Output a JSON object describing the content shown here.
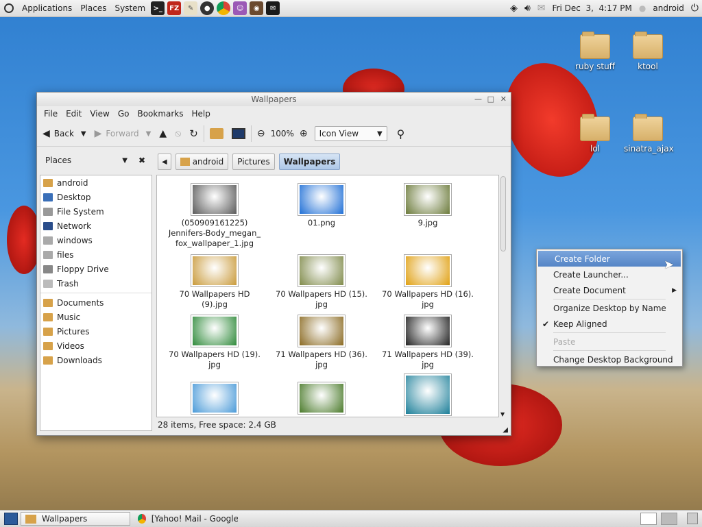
{
  "top_panel": {
    "menus": [
      "Applications",
      "Places",
      "System"
    ],
    "launchers": [
      "terminal-icon",
      "filezilla-icon",
      "text-editor-icon",
      "media-player-icon",
      "chrome-icon",
      "chat-icon",
      "camera-icon",
      "xchat-icon"
    ],
    "clock": "Fri Dec  3,  4:17 PM",
    "user": "android"
  },
  "desktop_icons": [
    "ruby stuff",
    "ktool",
    "lol",
    "sinatra_ajax"
  ],
  "window": {
    "title": "Wallpapers",
    "menu": [
      "File",
      "Edit",
      "View",
      "Go",
      "Bookmarks",
      "Help"
    ],
    "toolbar": {
      "back": "Back",
      "forward": "Forward",
      "zoom": "100%",
      "view_mode": "Icon View"
    },
    "sidebar": {
      "header": "Places",
      "items": [
        "android",
        "Desktop",
        "File System",
        "Network",
        "windows",
        "files",
        "Floppy Drive",
        "Trash"
      ],
      "bookmarks": [
        "Documents",
        "Music",
        "Pictures",
        "Videos",
        "Downloads"
      ]
    },
    "breadcrumbs": [
      "android",
      "Pictures",
      "Wallpapers"
    ],
    "files": [
      {
        "name": "(050909161225) Jennifers-Body_megan_ fox_wallpaper_1.jpg",
        "color": "#5a5a5a"
      },
      {
        "name": "01.png",
        "color": "#1f6fd6"
      },
      {
        "name": "9.jpg",
        "color": "#6b7a3a"
      },
      {
        "name": "70 Wallpapers HD (9).jpg",
        "color": "#c99a3a"
      },
      {
        "name": "70 Wallpapers HD (15). jpg",
        "color": "#7f8a4a"
      },
      {
        "name": "70 Wallpapers HD (16). jpg",
        "color": "#e0a012"
      },
      {
        "name": "70 Wallpapers HD (19). jpg",
        "color": "#2f8a3a"
      },
      {
        "name": "71 Wallpapers HD (36). jpg",
        "color": "#8a6a22"
      },
      {
        "name": "71 Wallpapers HD (39). jpg",
        "color": "#222222"
      },
      {
        "name": "",
        "color": "#4a9ad8"
      },
      {
        "name": "",
        "color": "#4a7a2a"
      },
      {
        "name": "",
        "color": "#1c7f99"
      }
    ],
    "status": "28 items, Free space: 2.4 GB"
  },
  "context_menu": [
    {
      "label": "Create Folder",
      "state": "selected"
    },
    {
      "label": "Create Launcher...",
      "state": "normal"
    },
    {
      "label": "Create Document",
      "state": "submenu"
    },
    {
      "label": "Organize Desktop by Name",
      "state": "normal"
    },
    {
      "label": "Keep Aligned",
      "state": "checked"
    },
    {
      "label": "Paste",
      "state": "disabled"
    },
    {
      "label": "Change Desktop Background",
      "state": "normal"
    }
  ],
  "taskbar": [
    {
      "label": "Wallpapers",
      "active": true
    },
    {
      "label": "[Yahoo! Mail - Google C...",
      "active": false
    }
  ]
}
